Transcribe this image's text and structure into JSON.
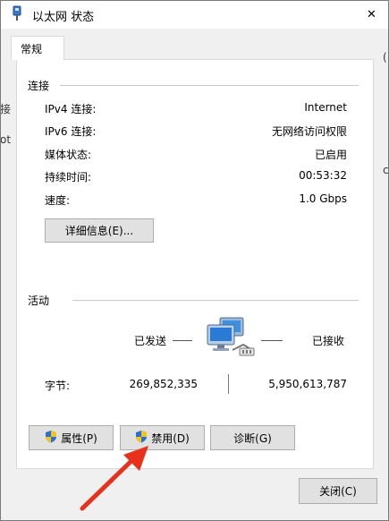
{
  "window": {
    "title": "以太网 状态",
    "close_glyph": "✕"
  },
  "tab": {
    "label": "常规"
  },
  "connection": {
    "section_title": "连接",
    "rows": [
      {
        "label": "IPv4 连接:",
        "value": "Internet"
      },
      {
        "label": "IPv6 连接:",
        "value": "无网络访问权限"
      },
      {
        "label": "媒体状态:",
        "value": "已启用"
      },
      {
        "label": "持续时间:",
        "value": "00:53:32"
      },
      {
        "label": "速度:",
        "value": "1.0 Gbps"
      }
    ],
    "details_button": "详细信息(E)..."
  },
  "activity": {
    "section_title": "活动",
    "sent_label": "已发送",
    "received_label": "已接收",
    "bytes_label": "字节:",
    "bytes_sent": "269,852,335",
    "bytes_received": "5,950,613,787"
  },
  "buttons": {
    "properties": "属性(P)",
    "disable": "禁用(D)",
    "diagnose": "诊断(G)",
    "close": "关闭(C)"
  },
  "background": {
    "left_fragments": [
      "接",
      "ot"
    ],
    "right_fragments": [
      "(",
      "c"
    ]
  },
  "colors": {
    "annotation_arrow": "#e8311a",
    "shield_blue": "#2a6fd6",
    "shield_yellow": "#f3c516"
  }
}
